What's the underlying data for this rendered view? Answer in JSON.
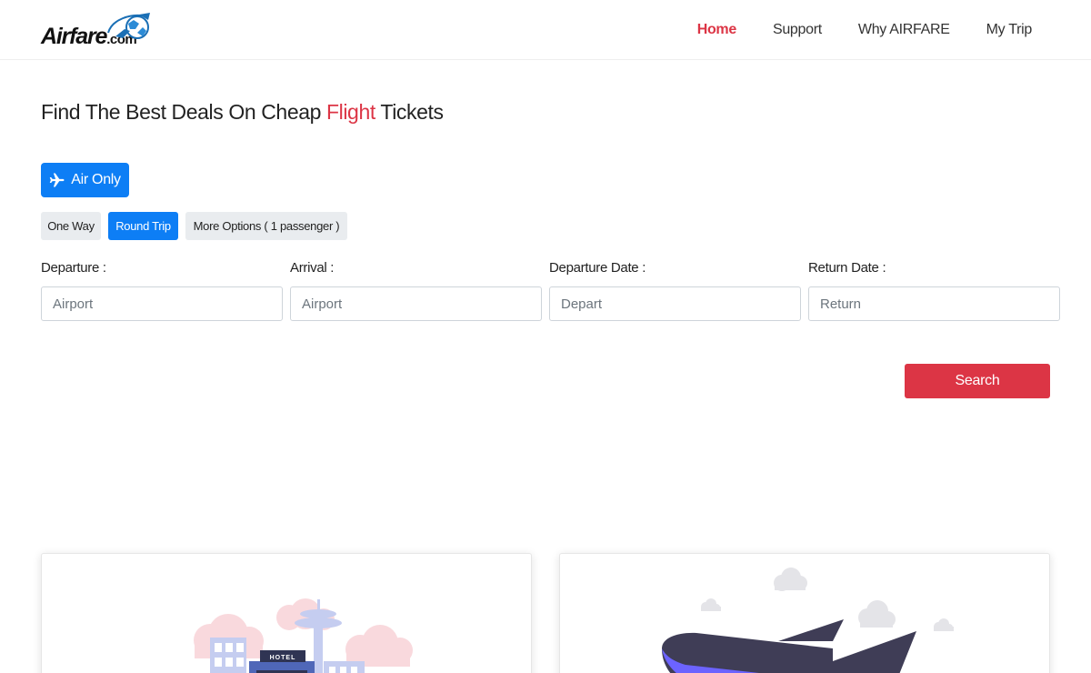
{
  "header": {
    "logo": {
      "name": "Airfare",
      "suffix": ".com"
    },
    "nav": [
      {
        "label": "Home",
        "active": true
      },
      {
        "label": "Support",
        "active": false
      },
      {
        "label": "Why AIRFARE",
        "active": false
      },
      {
        "label": "My Trip",
        "active": false
      }
    ]
  },
  "hero": {
    "title_before": "Find The Best Deals On Cheap ",
    "title_accent": "Flight",
    "title_after": " Tickets"
  },
  "search": {
    "product_button": {
      "label": "Air Only",
      "icon": "plane-icon"
    },
    "trip_types": [
      {
        "label": "One Way",
        "selected": false
      },
      {
        "label": "Round Trip",
        "selected": true
      },
      {
        "label": "More Options ( 1 passenger )",
        "selected": false
      }
    ],
    "fields": [
      {
        "label": "Departure :",
        "placeholder": "Airport",
        "value": ""
      },
      {
        "label": "Arrival :",
        "placeholder": "Airport",
        "value": ""
      },
      {
        "label": "Departure Date :",
        "placeholder": "Depart",
        "value": ""
      },
      {
        "label": "Return Date :",
        "placeholder": "Return",
        "value": ""
      }
    ],
    "submit_label": "Search"
  },
  "cards": {
    "hotel": {
      "sign_text": "HOTEL"
    }
  },
  "colors": {
    "accent_red": "#dc3545",
    "primary_blue": "#0d7ef5",
    "plane_purple": "#3f3d56",
    "plane_stripe": "#6c63ff"
  }
}
